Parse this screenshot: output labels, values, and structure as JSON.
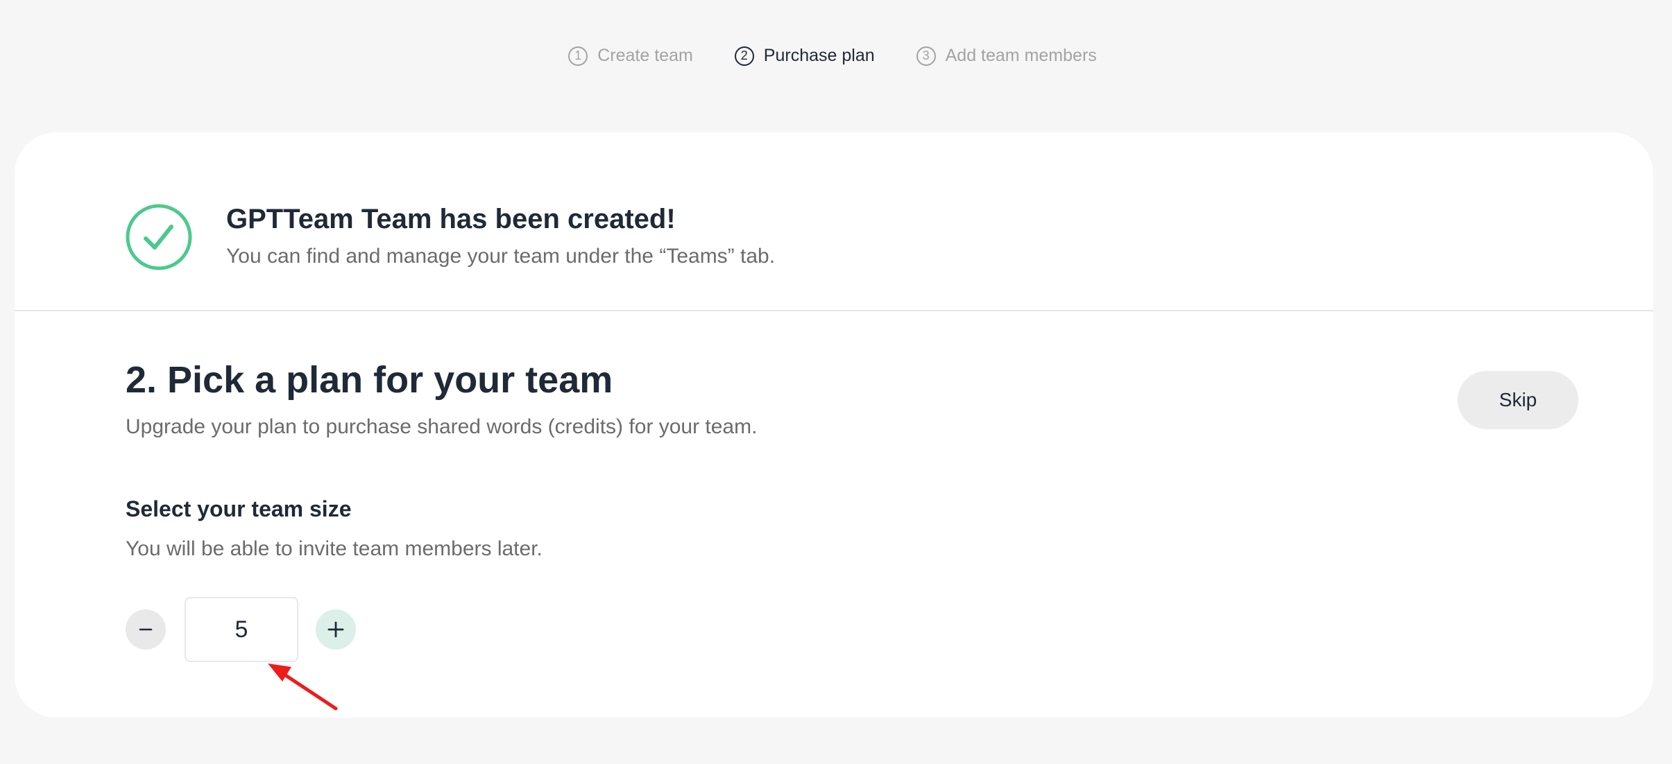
{
  "stepper": {
    "steps": [
      {
        "number": "1",
        "label": "Create team",
        "state": "inactive"
      },
      {
        "number": "2",
        "label": "Purchase plan",
        "state": "active"
      },
      {
        "number": "3",
        "label": "Add team members",
        "state": "inactive"
      }
    ]
  },
  "created_notice": {
    "icon": "check-circle-icon",
    "title": "GPTTeam Team has been created!",
    "subtitle": "You can find and manage your team under the “Teams” tab."
  },
  "plan_section": {
    "title": "2. Pick a plan for your team",
    "subtitle": "Upgrade your plan to purchase shared words (credits) for your team.",
    "skip_label": "Skip"
  },
  "team_size": {
    "title": "Select your team size",
    "subtitle": "You will be able to invite team members later.",
    "value": "5",
    "decrement_icon": "minus-icon",
    "increment_icon": "plus-icon"
  },
  "colors": {
    "success": "#4cc98d",
    "annotation_arrow": "#ee1c1c",
    "increment_bg": "#dcefe9"
  }
}
